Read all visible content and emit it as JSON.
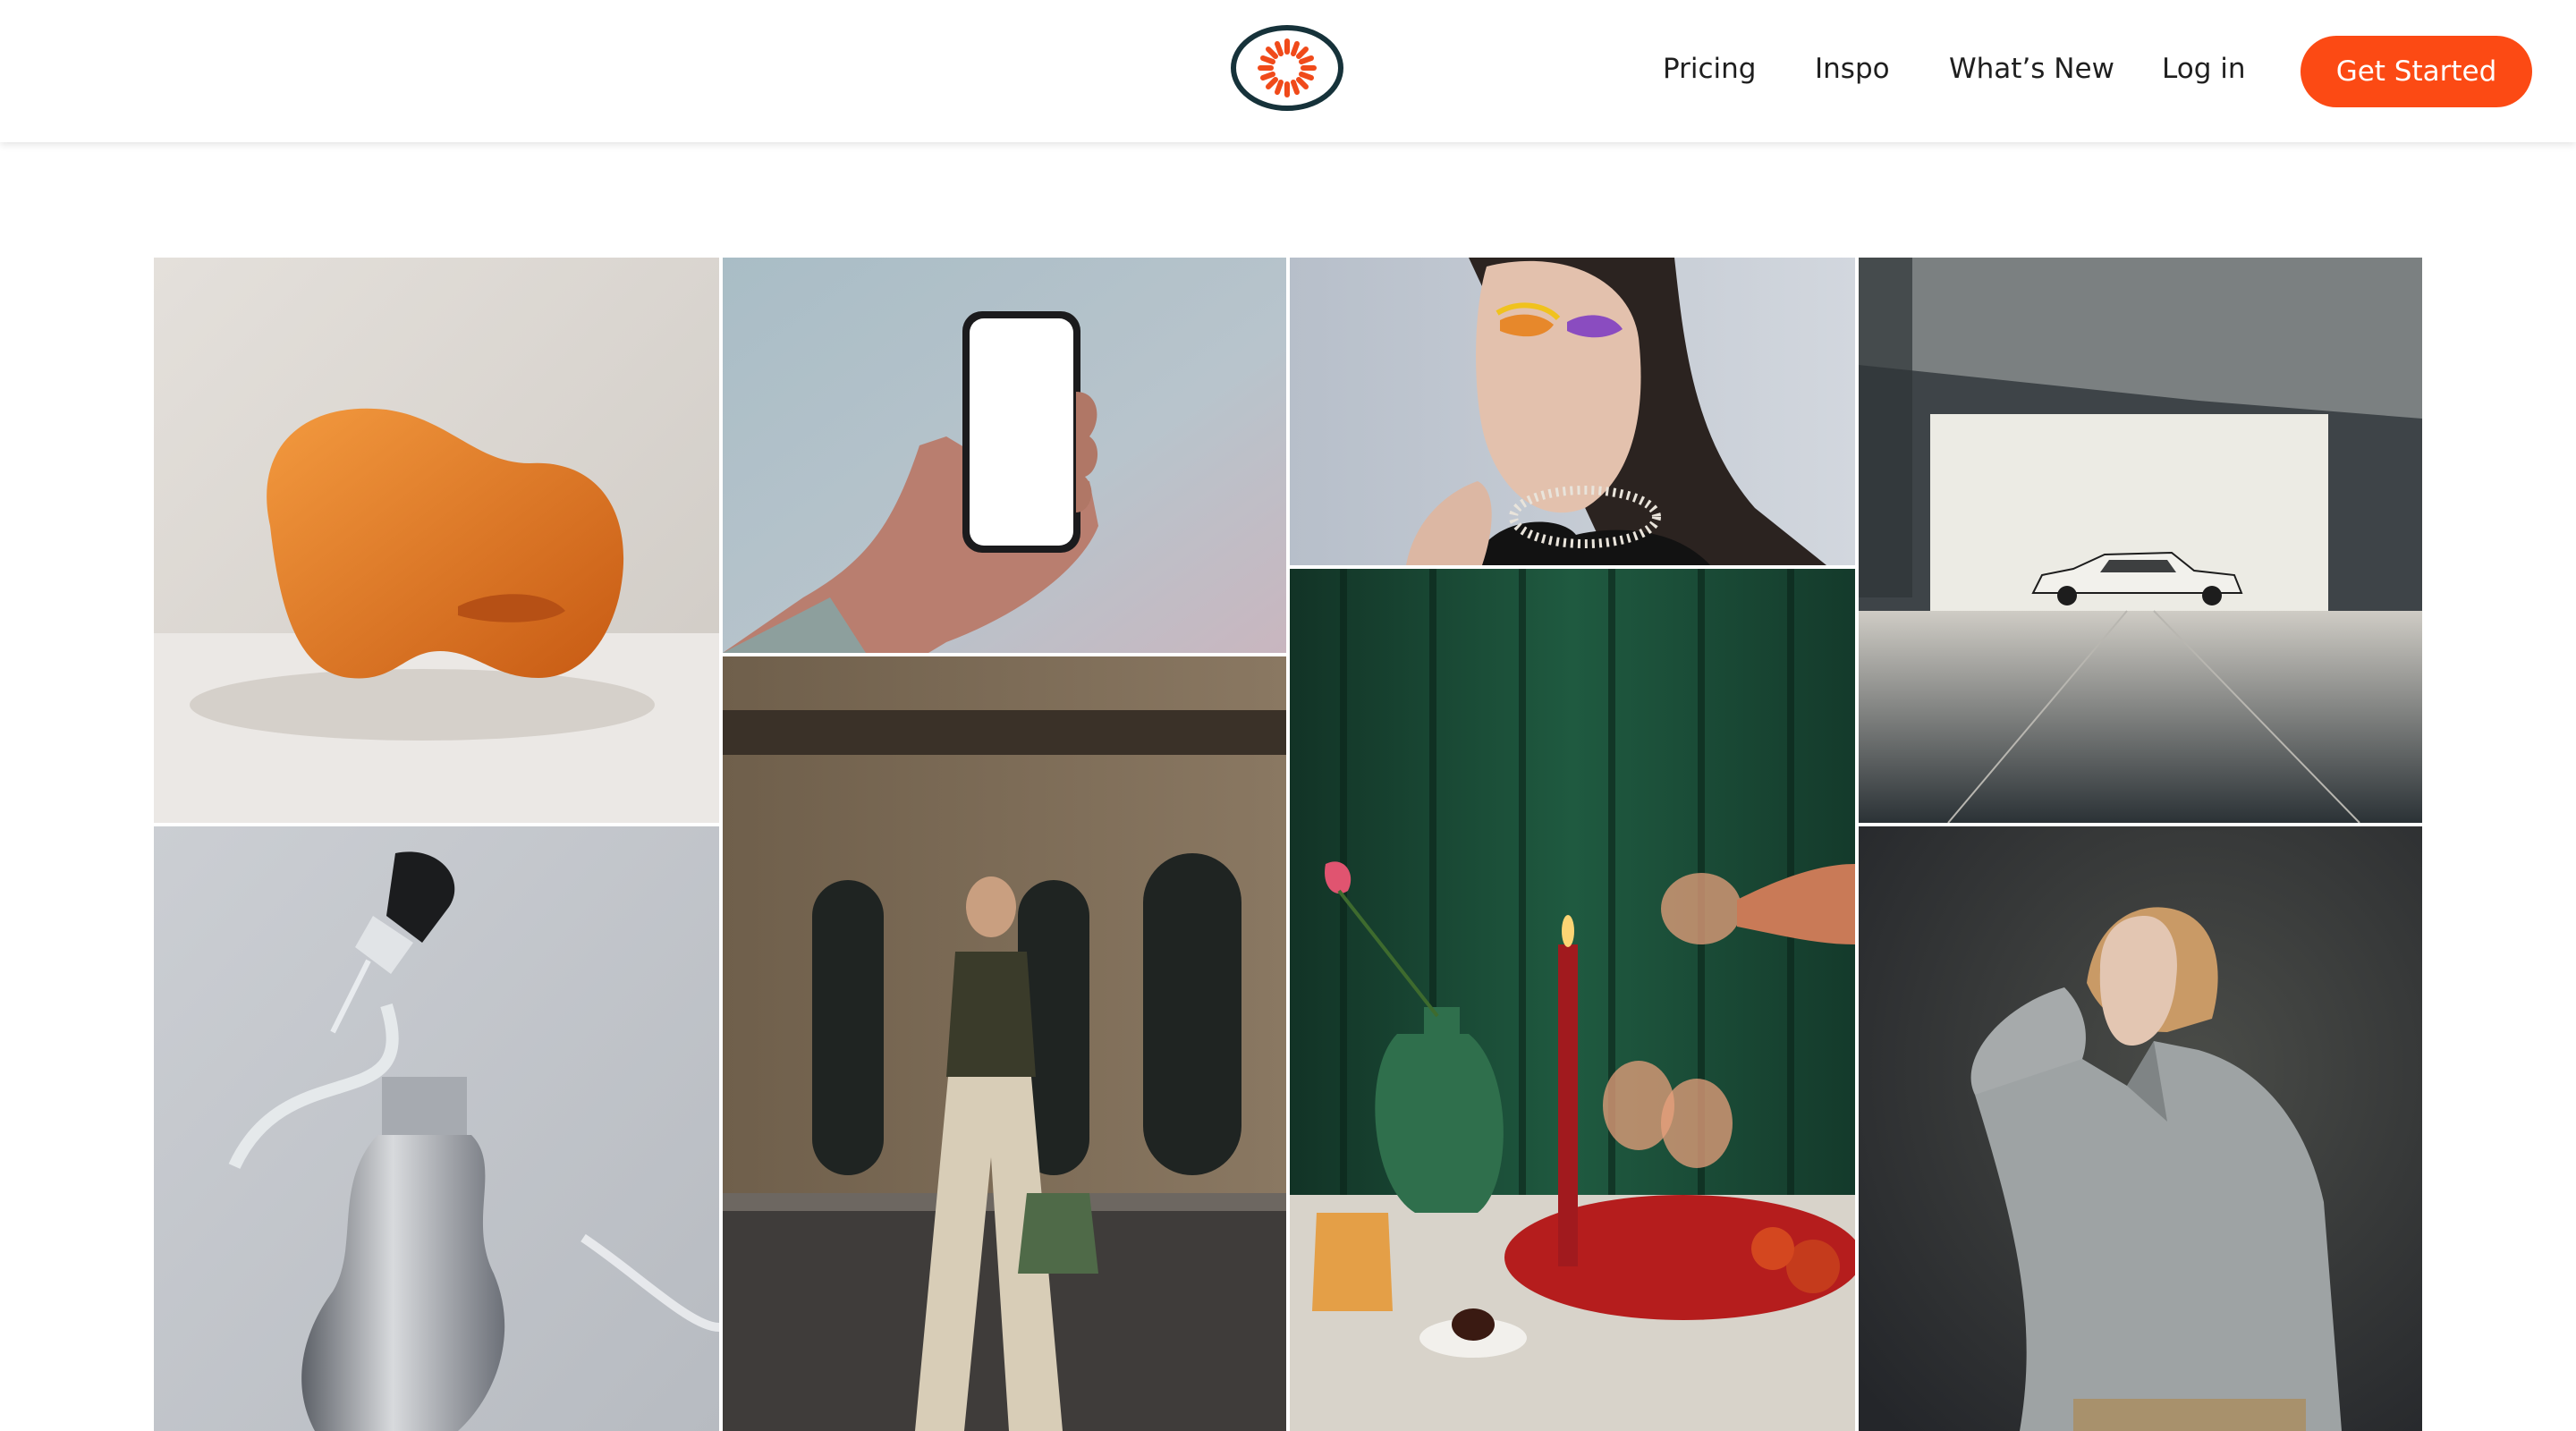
{
  "header": {
    "logo": {
      "icon": "starburst-logo-icon",
      "ring_color": "#16323a",
      "burst_color": "#f04a1a"
    },
    "nav": [
      {
        "id": "pricing",
        "label": "Pricing"
      },
      {
        "id": "inspo",
        "label": "Inspo"
      },
      {
        "id": "whats_new",
        "label": "What’s New"
      },
      {
        "id": "login",
        "label": "Log in"
      }
    ],
    "cta": {
      "label": "Get Started",
      "color": "#fc4a14"
    }
  },
  "gallery": {
    "images": [
      {
        "id": "orange-armchair",
        "subject": "orange armchair"
      },
      {
        "id": "hand-holding-phone",
        "subject": "hand holding phone"
      },
      {
        "id": "makeup-portrait",
        "subject": "makeup portrait"
      },
      {
        "id": "car-gallery",
        "subject": "white car in gallery"
      },
      {
        "id": "serum-bottle",
        "subject": "serum bottle with dropper"
      },
      {
        "id": "woman-walking",
        "subject": "woman walking street"
      },
      {
        "id": "candle-table",
        "subject": "candlelit table"
      },
      {
        "id": "grey-shirt-model",
        "subject": "model in grey shirt"
      }
    ]
  }
}
